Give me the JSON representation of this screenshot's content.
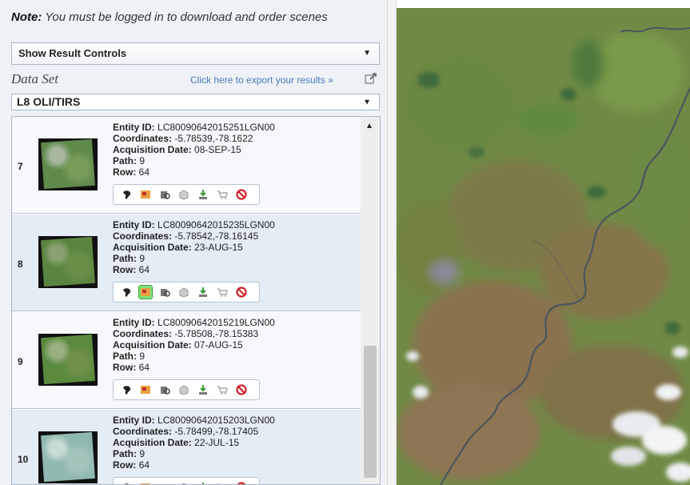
{
  "note": {
    "label": "Note:",
    "text": "You must be logged in to download and order scenes"
  },
  "result_controls": {
    "label": "Show Result Controls"
  },
  "dataset": {
    "heading": "Data Set",
    "export_link": "Click here to export your results »",
    "selected": "L8 OLI/TIRS"
  },
  "labels": {
    "entity_id": "Entity ID:",
    "coordinates": "Coordinates:",
    "acquisition_date": "Acquisition Date:",
    "path": "Path:",
    "row": "Row:"
  },
  "results": [
    {
      "num": "7",
      "entity_id": "LC80090642015251LGN00",
      "coordinates": "-5.78539,-78.1622",
      "acquisition_date": "08-SEP-15",
      "path": "9",
      "row": "64"
    },
    {
      "num": "8",
      "entity_id": "LC80090642015235LGN00",
      "coordinates": "-5.78542,-78.16145",
      "acquisition_date": "23-AUG-15",
      "path": "9",
      "row": "64"
    },
    {
      "num": "9",
      "entity_id": "LC80090642015219LGN00",
      "coordinates": "-5.78508,-78.15383",
      "acquisition_date": "07-AUG-15",
      "path": "9",
      "row": "64"
    },
    {
      "num": "10",
      "entity_id": "LC80090642015203LGN00",
      "coordinates": "-5.78499,-78.17405",
      "acquisition_date": "22-JUL-15",
      "path": "9",
      "row": "64"
    }
  ],
  "toolbar_icons": [
    "footprint-icon",
    "overlay-icon",
    "metadata-icon",
    "bulk-download-icon",
    "download-icon",
    "order-icon",
    "exclude-icon"
  ],
  "active_tool": {
    "row": 1,
    "tool": "overlay-icon"
  },
  "colors": {
    "panel_bg": "#eef2f6",
    "row_alt": "#e4ecf6",
    "link": "#4a7ab8",
    "exclude": "#d0212a",
    "map_green": "#6f8a44"
  }
}
